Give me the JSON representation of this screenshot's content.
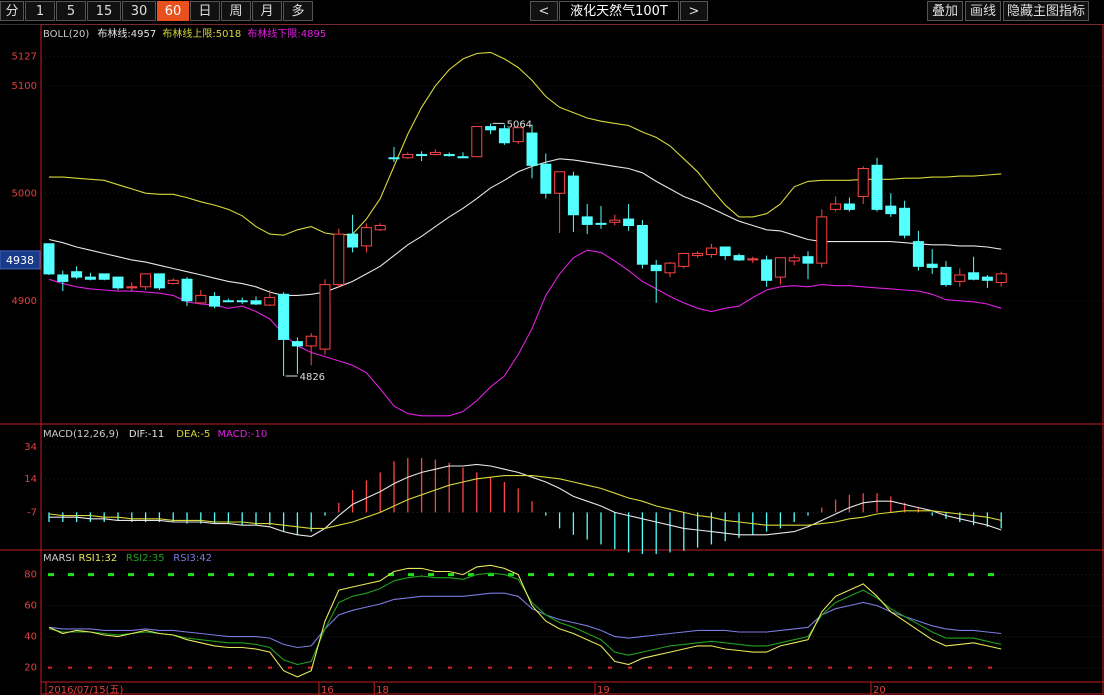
{
  "toolbar": {
    "periods": [
      "分",
      "1",
      "5",
      "15",
      "30",
      "60",
      "日",
      "周",
      "月",
      "多"
    ],
    "active_period": "60",
    "prev_label": "<",
    "next_label": ">",
    "symbol": "液化天然气100T",
    "right_buttons": [
      "叠加",
      "画线",
      "隐藏主图指标"
    ]
  },
  "colors": {
    "up": "#ff4444",
    "down": "#54ffff",
    "mid": "#e6e6e6",
    "upper": "#d8d83a",
    "lower": "#e020e0",
    "dif": "#e6e6e6",
    "dea": "#d8d83a",
    "rsi1": "#e8e85a",
    "rsi2": "#1fa01f",
    "rsi3": "#7a7ae0",
    "axis": "#c02020",
    "ob": "#18e818",
    "os": "#e02020"
  },
  "chart_data": [
    {
      "type": "candlestick",
      "indicator_label": "BOLL(20)",
      "legend": [
        {
          "label": "布林线:4957",
          "color": "#e6e6e6"
        },
        {
          "label": "布林线上限:5018",
          "color": "#d8d83a"
        },
        {
          "label": "布林线下限:4895",
          "color": "#e020e0"
        }
      ],
      "y_ticks": [
        5127,
        5100,
        5000,
        4900
      ],
      "y_range": [
        4790,
        5150
      ],
      "current_price": "4938",
      "annotations": {
        "high": "5064",
        "low": "4826"
      },
      "candles": [
        [
          4953,
          4953,
          4925,
          4924
        ],
        [
          4924,
          4928,
          4918,
          4909
        ],
        [
          4927,
          4932,
          4922,
          4920
        ],
        [
          4922,
          4926,
          4920,
          4919
        ],
        [
          4925,
          4925,
          4920,
          4919
        ],
        [
          4922,
          4922,
          4912,
          4910
        ],
        [
          4912,
          4917,
          4913,
          4909
        ],
        [
          4913,
          4925,
          4925,
          4910
        ],
        [
          4925,
          4925,
          4912,
          4910
        ],
        [
          4916,
          4921,
          4919,
          4915
        ],
        [
          4920,
          4922,
          4900,
          4895
        ],
        [
          4898,
          4910,
          4905,
          4898
        ],
        [
          4904,
          4908,
          4895,
          4893
        ],
        [
          4900,
          4902,
          4900,
          4900
        ],
        [
          4900,
          4903,
          4900,
          4897
        ],
        [
          4900,
          4904,
          4897,
          4896
        ],
        [
          4896,
          4910,
          4903,
          4895
        ],
        [
          4906,
          4908,
          4864,
          4830
        ],
        [
          4862,
          4866,
          4858,
          4832
        ],
        [
          4858,
          4870,
          4867,
          4840
        ],
        [
          4855,
          4920,
          4915,
          4850
        ],
        [
          4915,
          4967,
          4962,
          4912
        ],
        [
          4962,
          4980,
          4950,
          4945
        ],
        [
          4951,
          4972,
          4968,
          4945
        ],
        [
          4966,
          4972,
          4970,
          4965
        ],
        [
          5033,
          5043,
          5033,
          5029
        ],
        [
          5033,
          5038,
          5036,
          5032
        ],
        [
          5036,
          5039,
          5036,
          5030
        ],
        [
          5036,
          5041,
          5038,
          5035
        ],
        [
          5036,
          5038,
          5035,
          5034
        ],
        [
          5034,
          5038,
          5033,
          5033
        ],
        [
          5034,
          5062,
          5062,
          5034
        ],
        [
          5062,
          5065,
          5059,
          5055
        ],
        [
          5060,
          5064,
          5047,
          5045
        ],
        [
          5048,
          5061,
          5061,
          5046
        ],
        [
          5056,
          5064,
          5026,
          5014
        ],
        [
          5027,
          5037,
          5000,
          4995
        ],
        [
          5000,
          5020,
          5020,
          4963
        ],
        [
          5016,
          5020,
          4980,
          4964
        ],
        [
          4978,
          4990,
          4971,
          4962
        ],
        [
          4972,
          4988,
          4972,
          4967
        ],
        [
          4973,
          4980,
          4975,
          4970
        ],
        [
          4976,
          4990,
          4970,
          4965
        ],
        [
          4970,
          4975,
          4934,
          4930
        ],
        [
          4933,
          4938,
          4928,
          4898
        ],
        [
          4926,
          4936,
          4935,
          4922
        ],
        [
          4932,
          4940,
          4944,
          4930
        ],
        [
          4942,
          4946,
          4944,
          4940
        ],
        [
          4943,
          4953,
          4949,
          4940
        ],
        [
          4950,
          4950,
          4942,
          4938
        ],
        [
          4942,
          4944,
          4938,
          4937
        ],
        [
          4938,
          4941,
          4939,
          4935
        ],
        [
          4938,
          4942,
          4919,
          4913
        ],
        [
          4922,
          4940,
          4940,
          4915
        ],
        [
          4937,
          4943,
          4940,
          4933
        ],
        [
          4941,
          4946,
          4935,
          4920
        ],
        [
          4935,
          4985,
          4978,
          4931
        ],
        [
          4985,
          4997,
          4990,
          4983
        ],
        [
          4990,
          4996,
          4985,
          4983
        ],
        [
          4997,
          5025,
          5023,
          4990
        ],
        [
          5026,
          5033,
          4985,
          4983
        ],
        [
          4988,
          5000,
          4981,
          4978
        ],
        [
          4986,
          4993,
          4961,
          4958
        ],
        [
          4955,
          4965,
          4932,
          4928
        ],
        [
          4934,
          4948,
          4931,
          4925
        ],
        [
          4931,
          4937,
          4915,
          4913
        ],
        [
          4918,
          4930,
          4924,
          4913
        ],
        [
          4926,
          4941,
          4920,
          4919
        ],
        [
          4922,
          4924,
          4919,
          4912
        ],
        [
          4917,
          4927,
          4925,
          4913
        ]
      ],
      "mid_line": [
        4957,
        4954,
        4950,
        4947,
        4944,
        4941,
        4938,
        4936,
        4933,
        4930,
        4927,
        4924,
        4921,
        4918,
        4916,
        4913,
        4908,
        4905,
        4905,
        4906,
        4908,
        4913,
        4918,
        4925,
        4932,
        4942,
        4952,
        4960,
        4969,
        4978,
        4986,
        4995,
        5005,
        5012,
        5020,
        5025,
        5029,
        5032,
        5031,
        5029,
        5027,
        5025,
        5023,
        5019,
        5011,
        5004,
        4997,
        4992,
        4986,
        4980,
        4974,
        4970,
        4966,
        4965,
        4961,
        4957,
        4955,
        4955,
        4955,
        4955,
        4955,
        4955,
        4954,
        4953,
        4952,
        4952,
        4951,
        4951,
        4950,
        4948
      ],
      "upper_line": [
        5015,
        5015,
        5014,
        5013,
        5012,
        5008,
        5004,
        5000,
        4999,
        4999,
        4996,
        4992,
        4989,
        4985,
        4979,
        4969,
        4962,
        4961,
        4966,
        4969,
        4963,
        4961,
        4962,
        4976,
        4995,
        5025,
        5055,
        5080,
        5100,
        5115,
        5125,
        5130,
        5131,
        5125,
        5117,
        5105,
        5090,
        5080,
        5075,
        5070,
        5067,
        5065,
        5063,
        5057,
        5052,
        5044,
        5032,
        5020,
        5004,
        4989,
        4978,
        4978,
        4981,
        4990,
        5006,
        5011,
        5012,
        5012,
        5012,
        5013,
        5013,
        5013,
        5014,
        5014,
        5015,
        5015,
        5016,
        5016,
        5017,
        5018
      ],
      "lower_line": [
        4920,
        4916,
        4913,
        4911,
        4910,
        4909,
        4909,
        4908,
        4907,
        4905,
        4899,
        4897,
        4896,
        4893,
        4895,
        4890,
        4883,
        4869,
        4858,
        4852,
        4848,
        4844,
        4840,
        4833,
        4818,
        4802,
        4795,
        4793,
        4793,
        4793,
        4797,
        4807,
        4820,
        4830,
        4850,
        4874,
        4905,
        4925,
        4940,
        4947,
        4945,
        4937,
        4928,
        4918,
        4911,
        4904,
        4898,
        4893,
        4890,
        4893,
        4895,
        4903,
        4910,
        4913,
        4914,
        4913,
        4915,
        4914,
        4914,
        4913,
        4912,
        4911,
        4910,
        4909,
        4906,
        4901,
        4900,
        4899,
        4897,
        4893
      ]
    },
    {
      "type": "bar",
      "indicator_label": "MACD(12,26,9)",
      "legend": [
        {
          "label": "DIF:-11",
          "color": "#e6e6e6"
        },
        {
          "label": "DEA:-5",
          "color": "#d8d83a"
        },
        {
          "label": "MACD:-10",
          "color": "#e020e0"
        }
      ],
      "y_ticks": [
        34,
        14,
        -7
      ],
      "y_range": [
        -28,
        42
      ],
      "macd": [
        -6,
        -6,
        -6,
        -6,
        -6,
        -5,
        -6,
        -6,
        -6,
        -6,
        -7,
        -7,
        -7,
        -7,
        -8,
        -8,
        -8,
        -12,
        -14,
        -12,
        -2,
        6,
        14,
        20,
        25,
        32,
        34,
        34,
        33,
        31,
        28,
        25,
        22,
        19,
        15,
        7,
        -2,
        -10,
        -14,
        -17,
        -20,
        -23,
        -25,
        -26,
        -26,
        -25,
        -24,
        -22,
        -20,
        -18,
        -16,
        -14,
        -12,
        -10,
        -6,
        -2,
        3,
        8,
        11,
        12,
        12,
        10,
        6,
        3,
        -2,
        -4,
        -6,
        -8,
        -9,
        -10
      ],
      "dif": [
        -3,
        -3,
        -3,
        -4,
        -4,
        -5,
        -5,
        -5,
        -5,
        -6,
        -6,
        -6,
        -7,
        -7,
        -8,
        -8,
        -9,
        -12,
        -14,
        -15,
        -10,
        -2,
        5,
        9,
        13,
        18,
        22,
        25,
        27,
        29,
        29,
        30,
        29,
        27,
        25,
        22,
        19,
        15,
        10,
        7,
        4,
        0,
        -2,
        -4,
        -6,
        -8,
        -10,
        -11,
        -12,
        -13,
        -14,
        -14,
        -14,
        -13,
        -12,
        -9,
        -5,
        -1,
        3,
        6,
        7,
        7,
        5,
        3,
        1,
        -2,
        -4,
        -6,
        -8,
        -11
      ],
      "dea": [
        -1,
        -2,
        -2,
        -2,
        -3,
        -3,
        -4,
        -4,
        -4,
        -5,
        -5,
        -5,
        -6,
        -6,
        -6,
        -7,
        -7,
        -8,
        -9,
        -10,
        -10,
        -8,
        -6,
        -3,
        0,
        4,
        8,
        11,
        14,
        17,
        19,
        21,
        22,
        23,
        23,
        23,
        22,
        21,
        19,
        17,
        15,
        12,
        9,
        7,
        4,
        2,
        0,
        -2,
        -3,
        -5,
        -6,
        -7,
        -8,
        -8,
        -8,
        -8,
        -7,
        -6,
        -4,
        -3,
        -1,
        0,
        1,
        1,
        1,
        0,
        -1,
        -2,
        -3,
        -5
      ]
    },
    {
      "type": "line",
      "indicator_label": "MARSI",
      "legend": [
        {
          "label": "RSI1:32",
          "color": "#e8e85a"
        },
        {
          "label": "RSI2:35",
          "color": "#1fa01f"
        },
        {
          "label": "RSI3:42",
          "color": "#7a7ae0"
        }
      ],
      "y_ticks": [
        80,
        60,
        40,
        20
      ],
      "y_range": [
        12,
        92
      ],
      "overbought": 80,
      "oversold": 20,
      "rsi1": [
        46,
        42,
        44,
        43,
        41,
        40,
        42,
        44,
        42,
        41,
        38,
        36,
        34,
        33,
        33,
        32,
        30,
        18,
        14,
        18,
        50,
        70,
        72,
        74,
        76,
        82,
        84,
        84,
        82,
        82,
        80,
        85,
        86,
        84,
        80,
        60,
        50,
        45,
        42,
        38,
        34,
        24,
        22,
        26,
        28,
        30,
        32,
        34,
        34,
        32,
        31,
        30,
        30,
        34,
        36,
        38,
        56,
        66,
        70,
        74,
        66,
        56,
        50,
        44,
        38,
        34,
        35,
        36,
        34,
        32
      ],
      "rsi2": [
        45,
        43,
        43,
        43,
        42,
        41,
        42,
        43,
        42,
        41,
        39,
        38,
        37,
        36,
        36,
        35,
        33,
        25,
        22,
        24,
        45,
        62,
        66,
        68,
        71,
        76,
        78,
        79,
        78,
        78,
        77,
        80,
        81,
        80,
        77,
        62,
        54,
        49,
        46,
        42,
        38,
        30,
        28,
        30,
        32,
        34,
        35,
        36,
        37,
        36,
        35,
        34,
        34,
        36,
        38,
        40,
        54,
        62,
        66,
        70,
        65,
        58,
        53,
        48,
        43,
        39,
        39,
        39,
        37,
        35
      ],
      "rsi3": [
        46,
        45,
        45,
        45,
        44,
        44,
        44,
        45,
        44,
        44,
        43,
        42,
        41,
        40,
        40,
        40,
        39,
        35,
        33,
        34,
        45,
        54,
        57,
        59,
        61,
        64,
        65,
        66,
        66,
        66,
        66,
        67,
        68,
        68,
        66,
        58,
        54,
        51,
        49,
        47,
        44,
        40,
        39,
        40,
        41,
        42,
        43,
        44,
        44,
        44,
        43,
        43,
        43,
        44,
        45,
        46,
        54,
        58,
        60,
        62,
        60,
        56,
        53,
        50,
        47,
        45,
        44,
        44,
        43,
        42
      ]
    }
  ],
  "x_axis": {
    "labels": [
      {
        "text": "2016/07/15(五)",
        "index": 0
      },
      {
        "text": "16",
        "index": 20
      },
      {
        "text": "18",
        "index": 24
      },
      {
        "text": "19",
        "index": 40
      },
      {
        "text": "20",
        "index": 60
      }
    ]
  }
}
